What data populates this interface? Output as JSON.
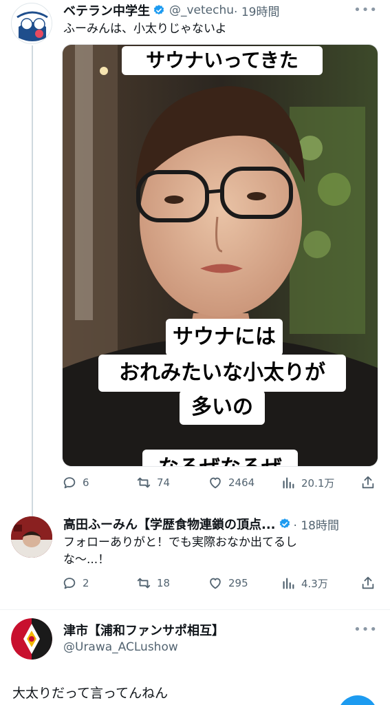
{
  "tweet1": {
    "display_name": "ベテラン中学生",
    "handle": "@_vetechu",
    "time": "· 19時間",
    "text": "ふーみんは、小太りじゃないよ",
    "media": {
      "caption_top": "サウナいってきた",
      "caption_mid_1": "サウナには",
      "caption_mid_2": "おれみたいな小太りが",
      "caption_mid_3": "多いの",
      "caption_bottom": "なるぜなるぜ"
    },
    "stats": {
      "replies": "6",
      "retweets": "74",
      "likes": "2464",
      "views": "20.1万"
    }
  },
  "tweet2": {
    "display_name": "高田ふーみん【学歴食物連鎖の頂点...",
    "time": "· 18時間",
    "text_line1": "フォローありがと！でも実際おなか出てるし",
    "text_line2": "な〜...！",
    "stats": {
      "replies": "2",
      "retweets": "18",
      "likes": "295",
      "views": "4.3万"
    }
  },
  "tweet3": {
    "display_name": "津市【浦和ファンサポ相互】",
    "handle": "@Urawa_ACLushow",
    "text": "大太りだって言ってんねん"
  },
  "more_label": "•••",
  "colors": {
    "accent": "#1d9bf0",
    "secondary_text": "#536471",
    "thread": "#cfd9de"
  }
}
